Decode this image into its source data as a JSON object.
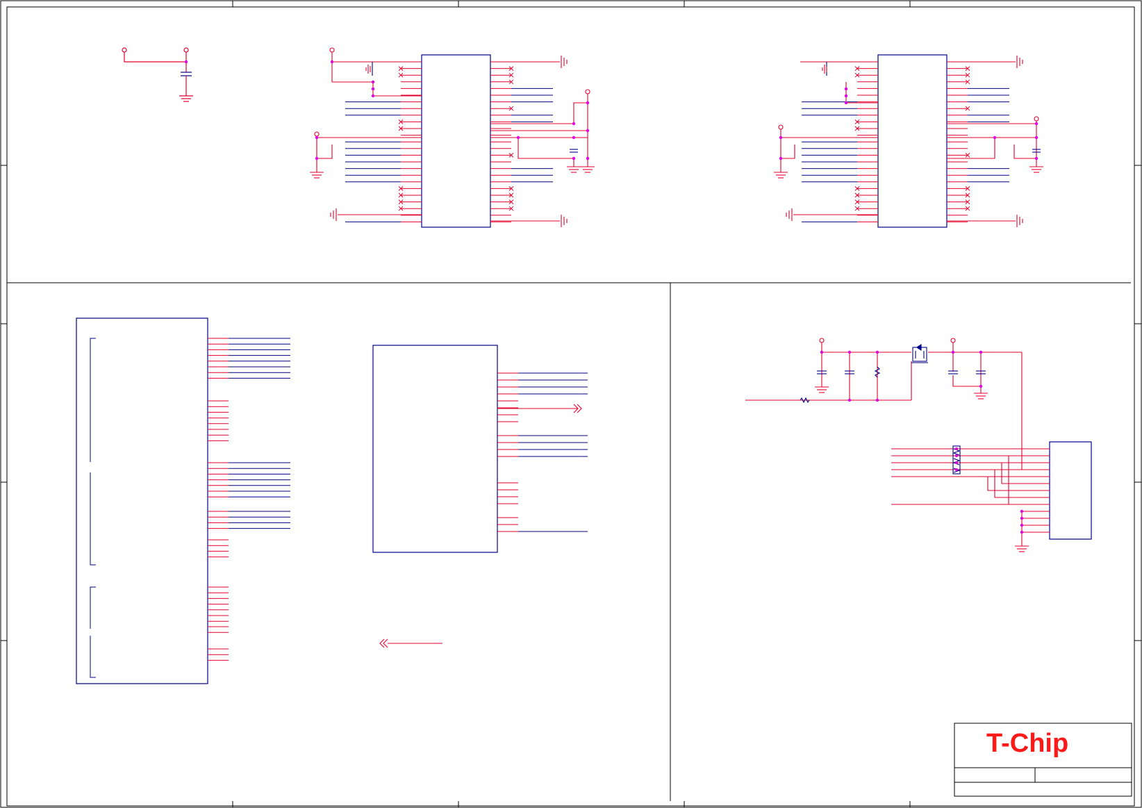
{
  "title_block": {
    "logo_text": "T-Chip"
  },
  "colors": {
    "wire": "#e4002b",
    "bus": "#000080",
    "component": "#00008b",
    "junction": "#e000e0",
    "frame": "#000000"
  }
}
